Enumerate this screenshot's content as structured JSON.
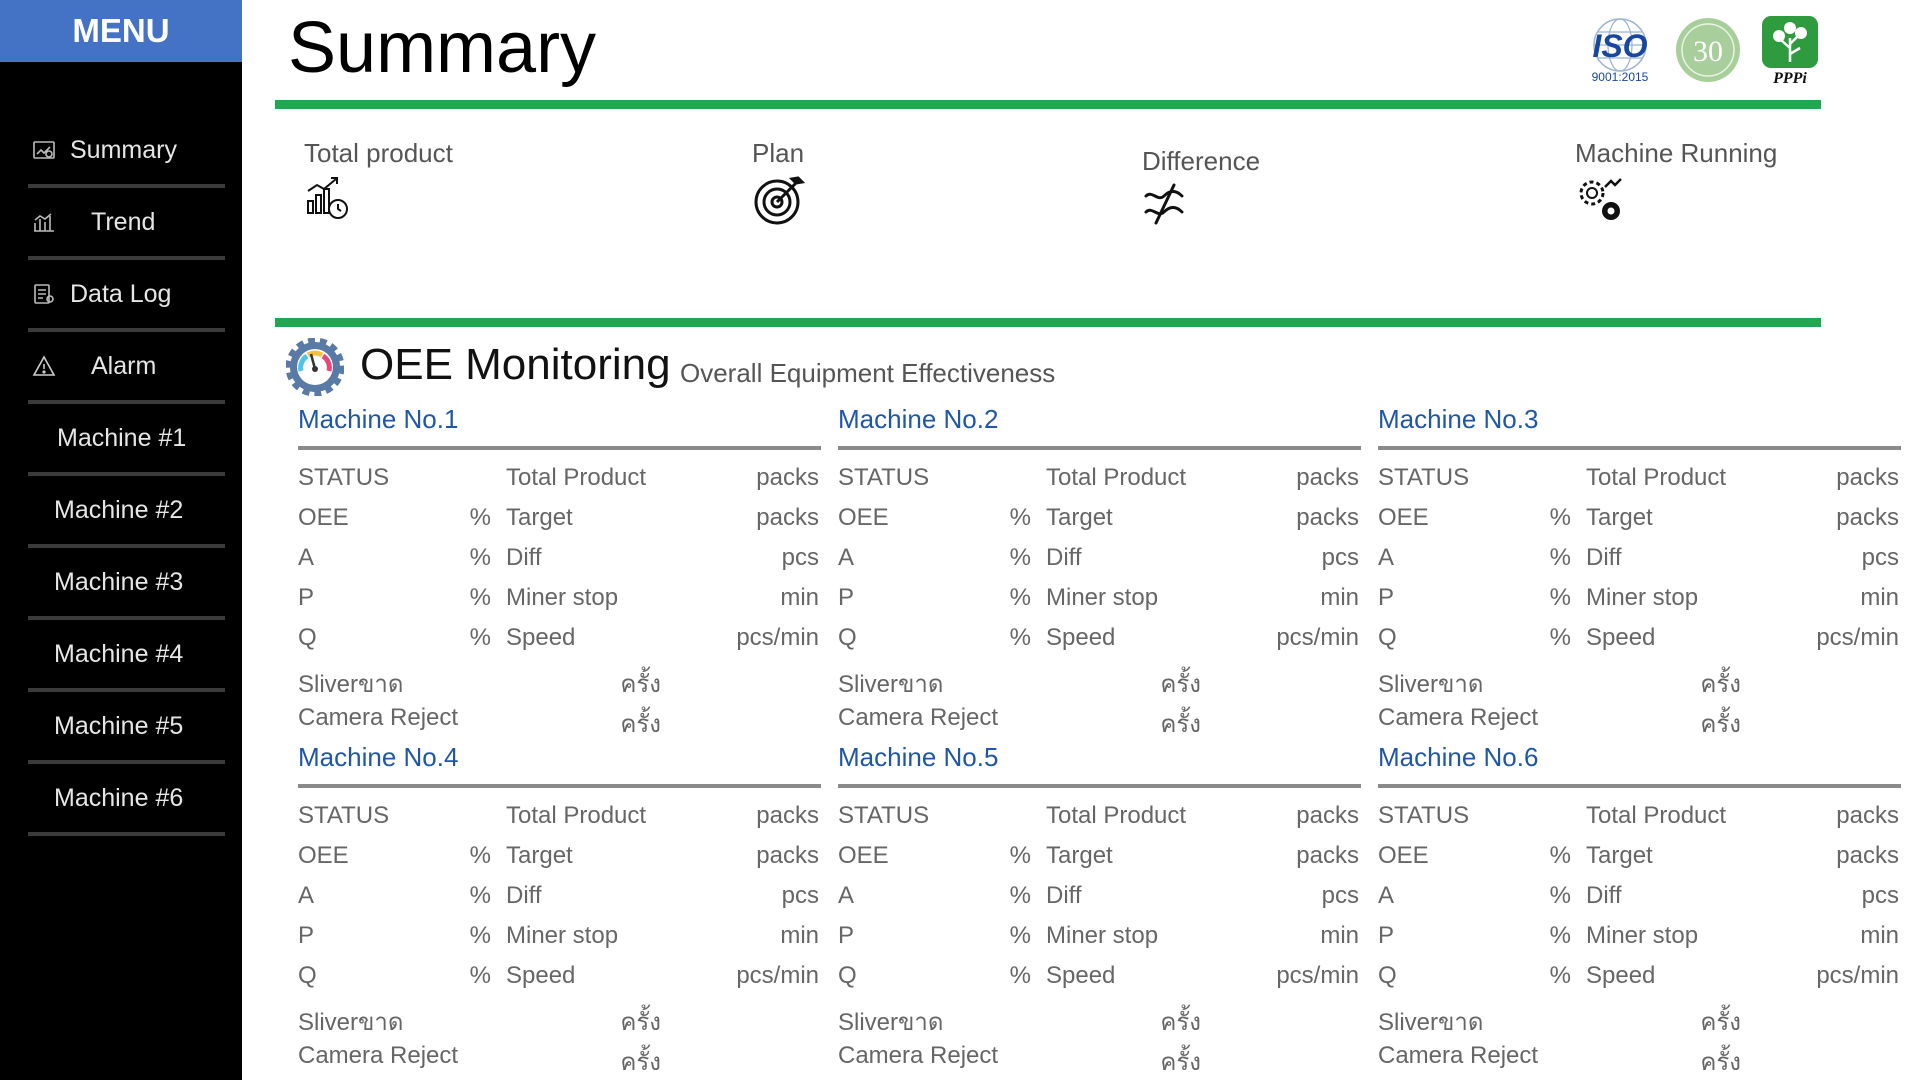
{
  "sidebar": {
    "menu_label": "MENU",
    "items": [
      {
        "label": "Summary",
        "icon": "summary-icon"
      },
      {
        "label": "Trend",
        "icon": "trend-icon"
      },
      {
        "label": "Data Log",
        "icon": "data-log-icon"
      },
      {
        "label": "Alarm",
        "icon": "alarm-warning-icon"
      },
      {
        "label": "Machine #1"
      },
      {
        "label": "Machine #2"
      },
      {
        "label": "Machine #3"
      },
      {
        "label": "Machine #4"
      },
      {
        "label": "Machine #5"
      },
      {
        "label": "Machine #6"
      }
    ]
  },
  "header": {
    "title": "Summary",
    "logos": {
      "iso_main": "ISO",
      "iso_sub": "9001:2015",
      "anniversary": "30",
      "brand": "PPPi"
    }
  },
  "summary": {
    "total_product": "Total product",
    "plan": "Plan",
    "difference": "Difference",
    "machine_running": "Machine Running"
  },
  "oee": {
    "title": "OEE Monitoring",
    "subtitle": "Overall Equipment Effectiveness"
  },
  "labels": {
    "status": "STATUS",
    "oee": "OEE",
    "a": "A",
    "p": "P",
    "q": "Q",
    "sliver": "Sliverขาด",
    "camera_reject": "Camera Reject",
    "total_product": "Total Product",
    "target": "Target",
    "diff": "Diff",
    "miner_stop": "Miner stop",
    "speed": "Speed",
    "percent": "%",
    "packs": "packs",
    "pcs": "pcs",
    "min": "min",
    "pcs_min": "pcs/min",
    "times": "ครั้ง"
  },
  "machines": [
    {
      "title": "Machine No.1"
    },
    {
      "title": "Machine No.2"
    },
    {
      "title": "Machine No.3"
    },
    {
      "title": "Machine No.4"
    },
    {
      "title": "Machine No.5"
    },
    {
      "title": "Machine No.6"
    }
  ],
  "colors": {
    "sidebar_bg": "#000000",
    "menu_header": "#4472c4",
    "accent_green": "#1fa84f",
    "machine_title": "#1f57a6"
  }
}
